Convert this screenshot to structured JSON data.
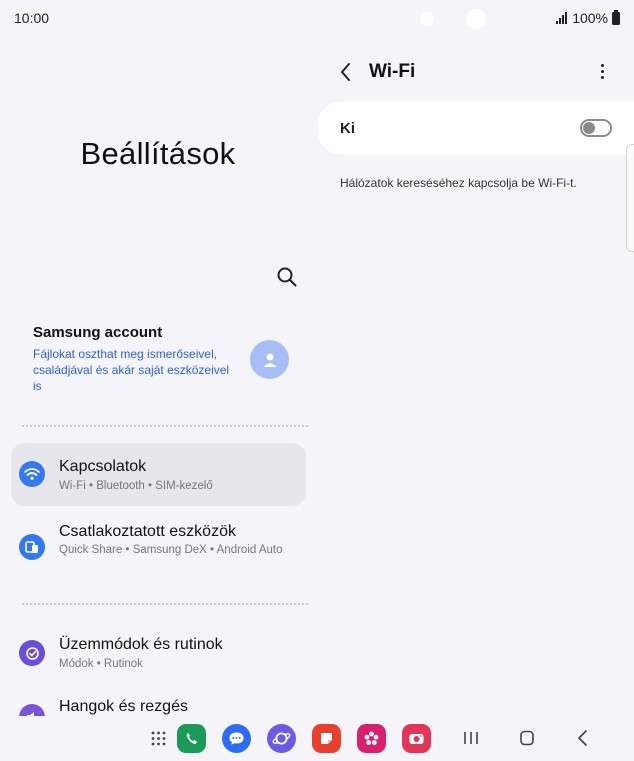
{
  "status": {
    "time": "10:00",
    "battery": "100%",
    "icons": [
      "camera-dot",
      "signal-icon",
      "battery-icon"
    ]
  },
  "settings": {
    "title": "Beállítások",
    "search_icon": "search-icon",
    "account": {
      "name": "Samsung account",
      "description": "Fájlokat oszthat meg ismerőseivel, családjával és akár saját eszközeivel is",
      "avatar_icon": "person-icon"
    },
    "items": [
      {
        "title": "Kapcsolatok",
        "subtitle": "Wi-Fi  •  Bluetooth  •  SIM-kezelő",
        "icon": "wifi-icon",
        "color": "#3478f0",
        "active": true
      },
      {
        "title": "Csatlakoztatott eszközök",
        "subtitle": "Quick Share  •  Samsung DeX  •  Android Auto",
        "icon": "devices-icon",
        "color": "#3478f0",
        "active": false
      },
      {
        "title": "Üzemmódok és rutinok",
        "subtitle": "Módok  •  Rutinok",
        "icon": "modes-icon",
        "color": "#6c4ed8",
        "active": false
      },
      {
        "title": "Hangok és rezgés",
        "subtitle": "",
        "icon": "sound-icon",
        "color": "#7a55dc",
        "active": false
      }
    ]
  },
  "wifi": {
    "title": "Wi-Fi",
    "toggle_label": "Ki",
    "toggle_on": false,
    "hint": "Hálózatok kereséséhez kapcsolja be Wi-Fi-t."
  },
  "dock": {
    "apps": [
      {
        "name": "apps-grid-icon",
        "color": "#444444"
      },
      {
        "name": "phone-icon",
        "color": "#1b9a58"
      },
      {
        "name": "messages-icon",
        "color": "#2d6cf0"
      },
      {
        "name": "internet-icon",
        "color": "#6a5be2"
      },
      {
        "name": "notes-icon",
        "color": "#e8402f"
      },
      {
        "name": "gallery-icon",
        "color": "#d6226e"
      },
      {
        "name": "camera-icon",
        "color": "#e2355a"
      }
    ],
    "nav": [
      "recents-icon",
      "home-icon",
      "back-icon"
    ]
  }
}
